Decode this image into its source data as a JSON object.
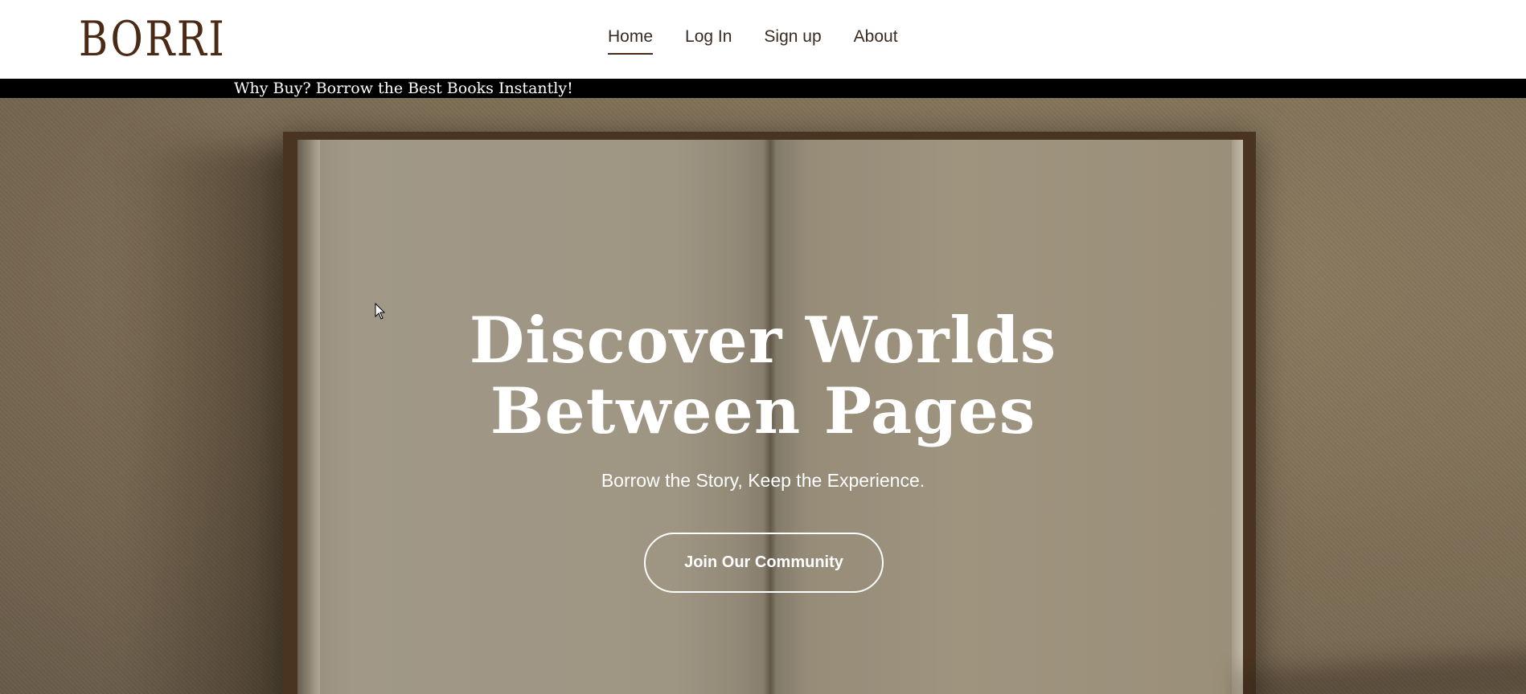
{
  "brand": {
    "logo_text": "BORRI",
    "logo_color": "#4a2a14"
  },
  "nav": {
    "items": [
      {
        "label": "Home",
        "active": true
      },
      {
        "label": "Log In",
        "active": false
      },
      {
        "label": "Sign up",
        "active": false
      },
      {
        "label": "About",
        "active": false
      }
    ]
  },
  "ticker": {
    "text": "Why Buy? Borrow the Best Books Instantly!"
  },
  "hero": {
    "title_line1": "Discover Worlds",
    "title_line2": "Between Pages",
    "subtitle": "Borrow the Story, Keep the Experience.",
    "cta_label": "Join Our Community"
  },
  "colors": {
    "background_tan": "#8a7d66",
    "text_white": "#ffffff",
    "nav_text": "#3a2a20",
    "ticker_bg": "#000000"
  },
  "icons": {
    "cursor": "mouse-pointer-icon"
  }
}
